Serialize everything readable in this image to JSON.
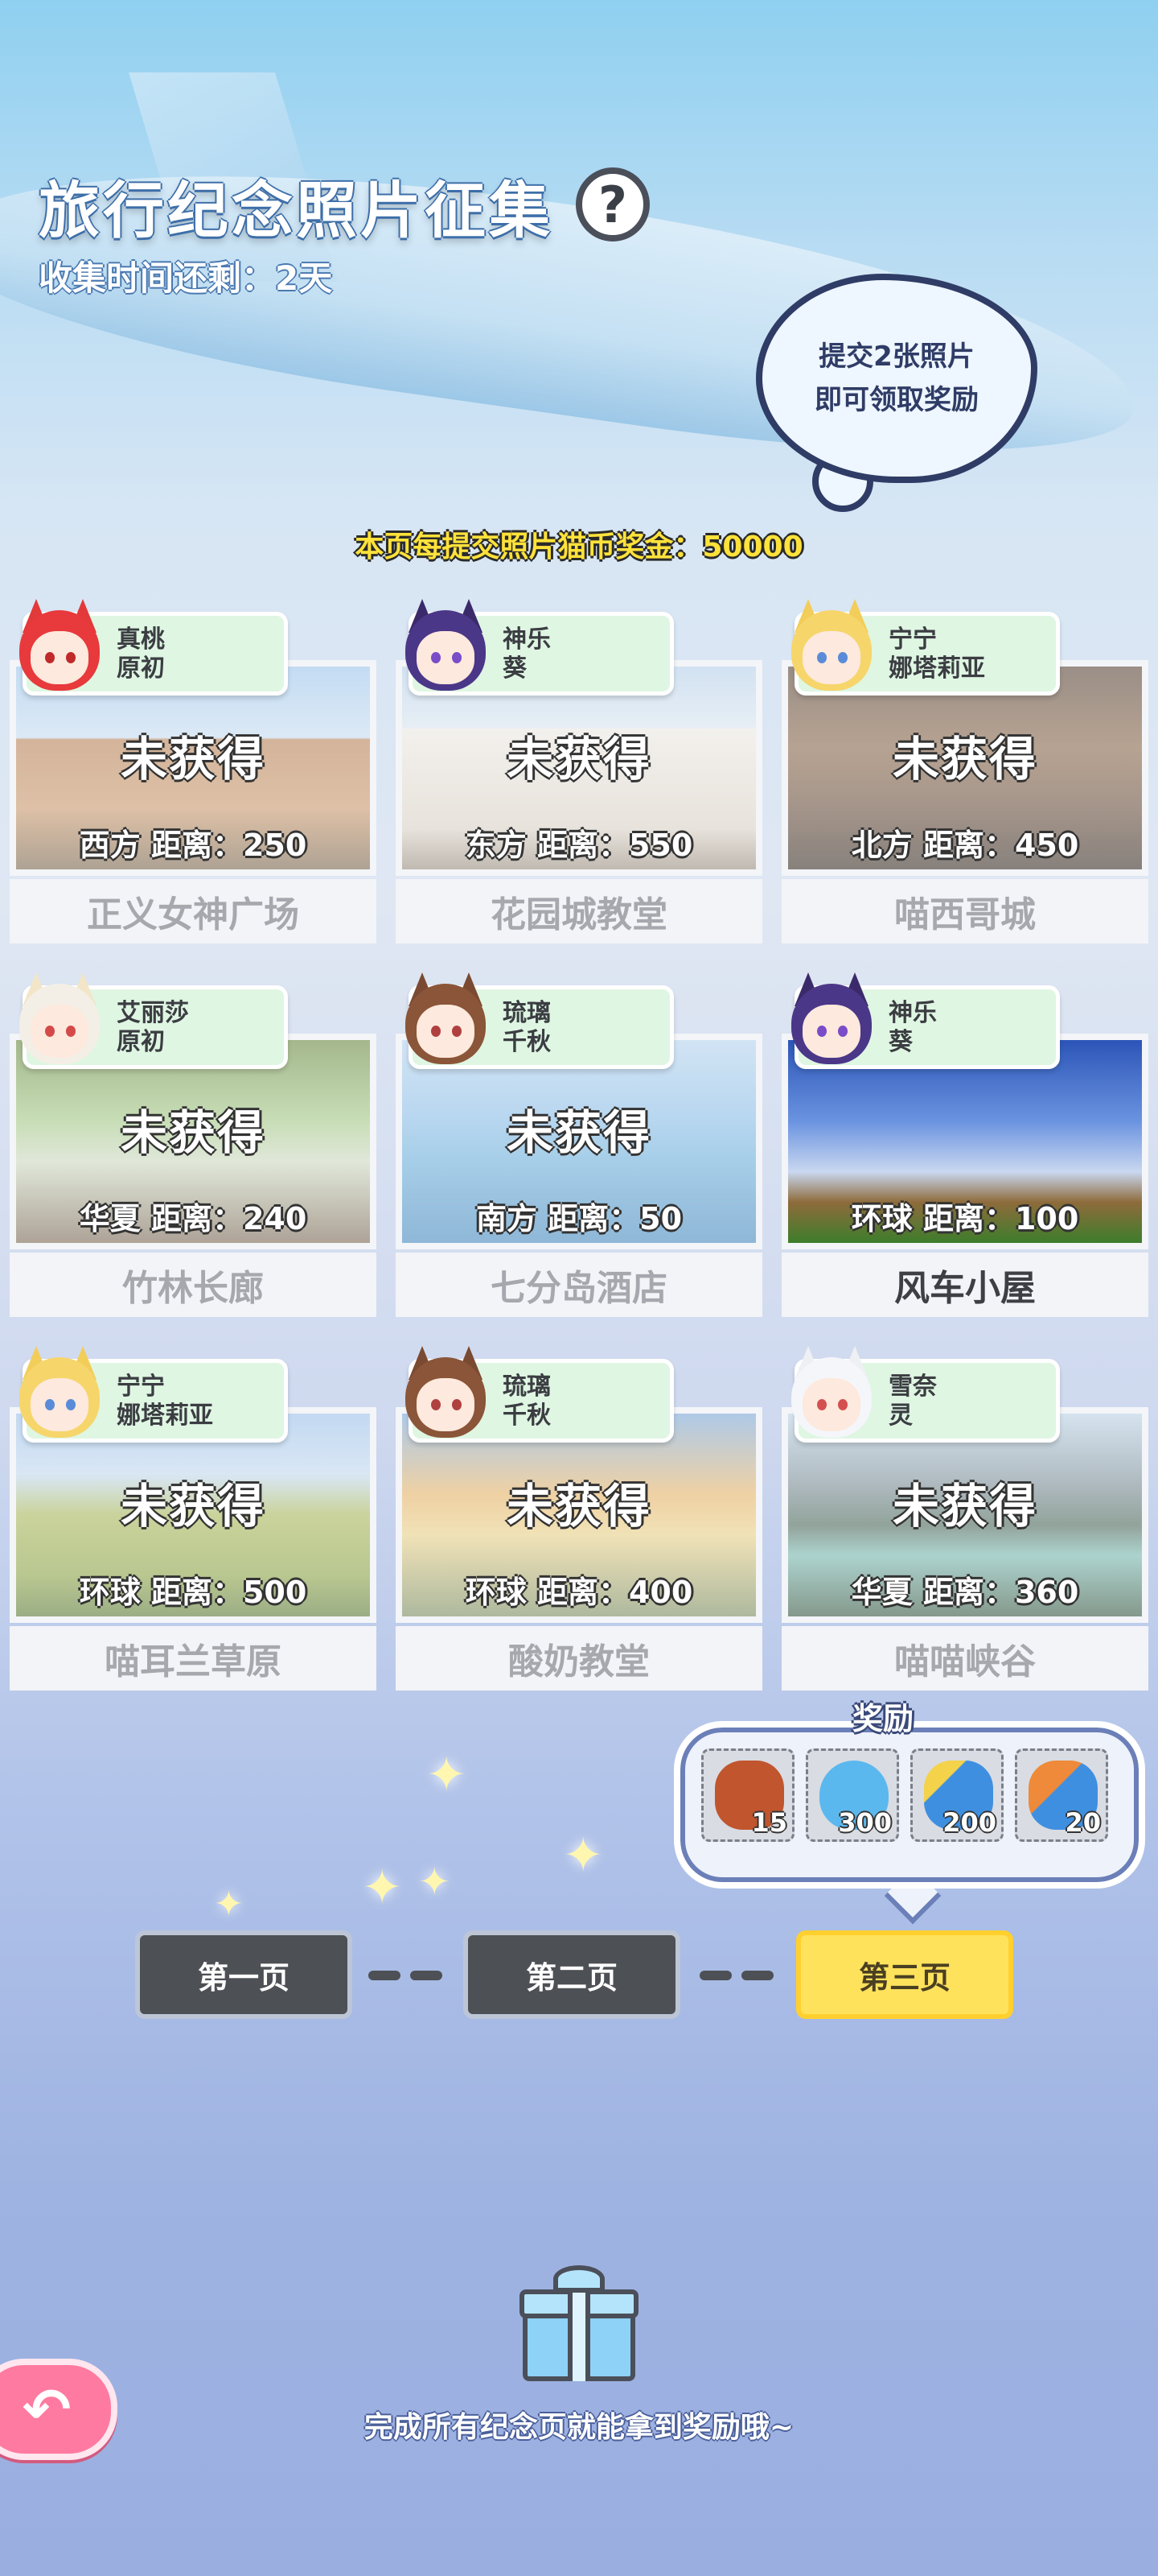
{
  "header": {
    "title": "旅行纪念照片征集",
    "help_icon": "?",
    "timer": "收集时间还剩：2天",
    "cloud_line1": "提交2张照片",
    "cloud_line2": "即可领取奖励",
    "bonus": "本页每提交照片猫币奖金：50000"
  },
  "cards": [
    {
      "tag1": "真桃",
      "tag2": "原初",
      "status": "未获得",
      "distance": "西方  距离：250",
      "name": "正义女神广场"
    },
    {
      "tag1": "神乐",
      "tag2": "葵",
      "status": "未获得",
      "distance": "东方  距离：550",
      "name": "花园城教堂"
    },
    {
      "tag1": "宁宁",
      "tag2": "娜塔莉亚",
      "status": "未获得",
      "distance": "北方  距离：450",
      "name": "喵西哥城"
    },
    {
      "tag1": "艾丽莎",
      "tag2": "原初",
      "status": "未获得",
      "distance": "华夏  距离：240",
      "name": "竹林长廊"
    },
    {
      "tag1": "琉璃",
      "tag2": "千秋",
      "status": "未获得",
      "distance": "南方  距离：50",
      "name": "七分岛酒店"
    },
    {
      "tag1": "神乐",
      "tag2": "葵",
      "status": "",
      "distance": "环球  距离：100",
      "name": "风车小屋"
    },
    {
      "tag1": "宁宁",
      "tag2": "娜塔莉亚",
      "status": "未获得",
      "distance": "环球  距离：500",
      "name": "喵耳兰草原"
    },
    {
      "tag1": "琉璃",
      "tag2": "千秋",
      "status": "未获得",
      "distance": "环球  距离：400",
      "name": "酸奶教堂"
    },
    {
      "tag1": "雪奈",
      "tag2": "灵",
      "status": "未获得",
      "distance": "华夏  距离：360",
      "name": "喵喵峡谷"
    }
  ],
  "reward": {
    "title": "奖励",
    "items": [
      {
        "icon": "coin-bag-icon",
        "count": "15",
        "color": "#c0552e"
      },
      {
        "icon": "blue-slime-icon",
        "count": "300",
        "color": "#5bb8ee"
      },
      {
        "icon": "blue-ticket-icon",
        "count": "200",
        "color": "#3f8fe0"
      },
      {
        "icon": "orange-ticket-icon",
        "count": "20",
        "color": "#ee8a3a"
      }
    ]
  },
  "pages": {
    "p1": "第一页",
    "p2": "第二页",
    "p3": "第三页"
  },
  "footer": {
    "hint": "完成所有纪念页就能拿到奖励哦~"
  },
  "colors": {
    "accent_yellow": "#ffe25c",
    "tag_green": "#dff6e3",
    "back_pink": "#ff7aa0"
  }
}
